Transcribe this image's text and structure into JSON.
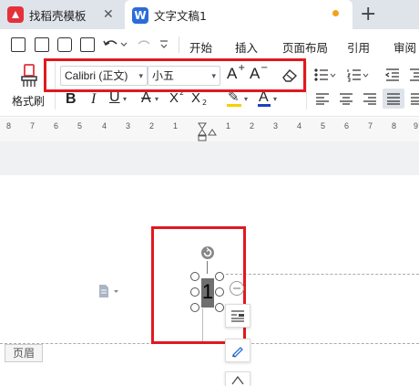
{
  "tabs": [
    {
      "label": "找稻壳模板",
      "icon": "W"
    },
    {
      "label": "文字文稿1",
      "icon": "W"
    }
  ],
  "tab_close": "✕",
  "new_tab": "+",
  "menu": [
    "开始",
    "插入",
    "页面布局",
    "引用",
    "审阅"
  ],
  "ribbon": {
    "format_painter": "格式刷",
    "font_name": "Calibri (正文)",
    "font_size": "小五",
    "grow": "A",
    "shrink": "A",
    "bold": "B",
    "italic": "I",
    "underline": "U",
    "strike": "A",
    "superscript": "X",
    "subscript": "X",
    "sup_mark": "2",
    "sub_mark": "2",
    "highlight": "✎",
    "font_color": "A"
  },
  "ruler_numbers": [
    "8",
    "7",
    "6",
    "5",
    "4",
    "3",
    "2",
    "1",
    "1",
    "2",
    "3",
    "4",
    "5",
    "6",
    "7",
    "8",
    "9"
  ],
  "document": {
    "page_number": "1",
    "header_label": "页眉"
  },
  "colors": {
    "accent_red": "#e0191f",
    "wps_red": "#e5313a",
    "wps_blue": "#2b6cd9",
    "highlight_yellow": "#f5d000",
    "font_color_blue": "#1f3fbf"
  }
}
